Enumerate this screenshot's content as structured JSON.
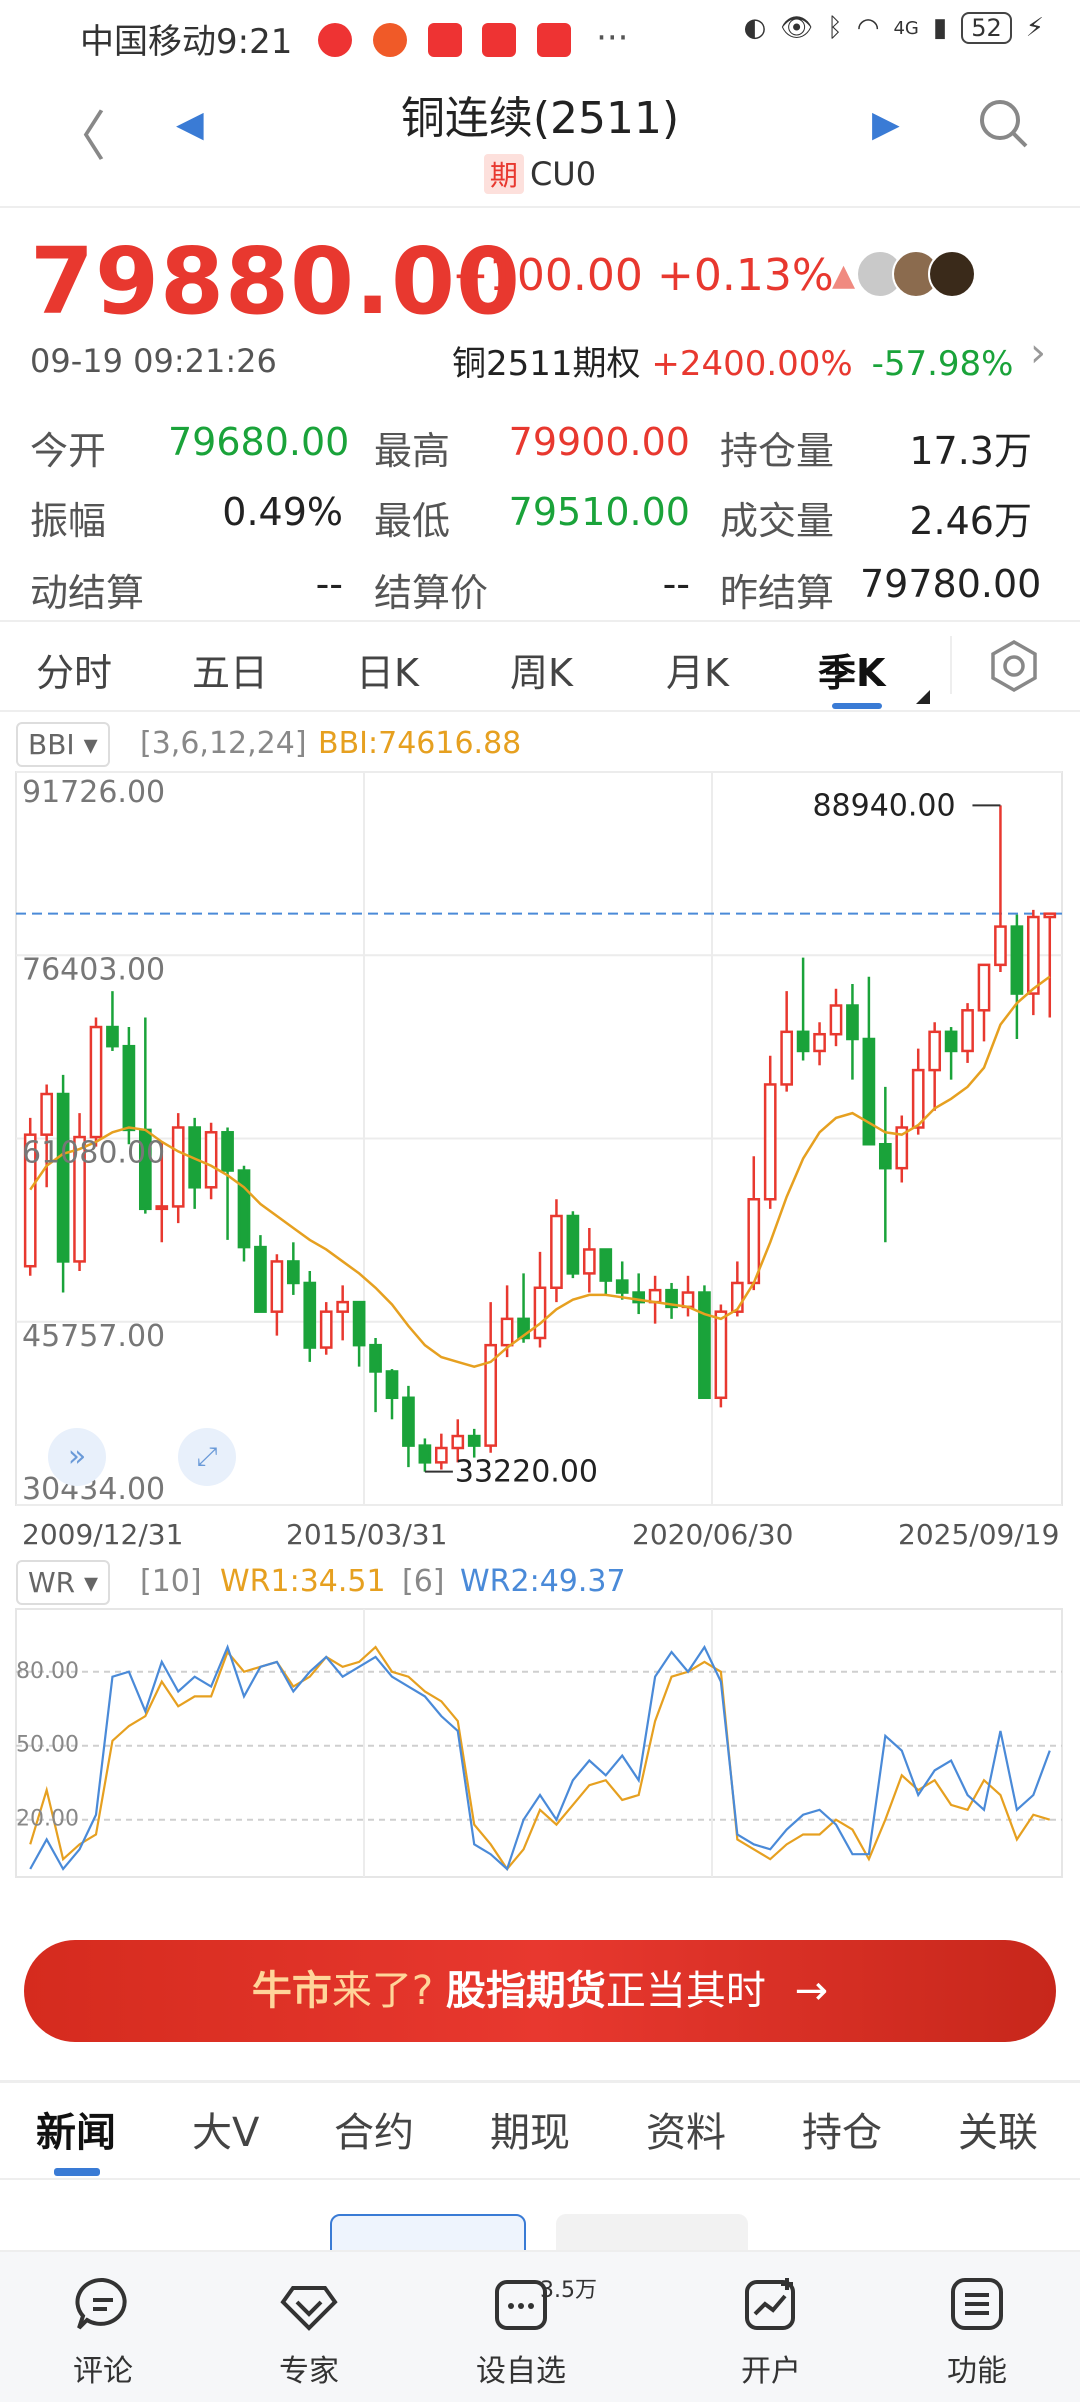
{
  "status_bar": {
    "carrier_time": "中国移动9:21",
    "network": "4G",
    "battery": "52"
  },
  "header": {
    "title": "铜连续(2511)",
    "badge": "期",
    "code": "CU0"
  },
  "quote": {
    "price": "79880.00",
    "change": "+100.00",
    "change_pct": "+0.13%",
    "datetime": "09-19 09:21:26",
    "option_name": "铜2511期权",
    "option_pct1": "+2400.00%",
    "option_pct2": "-57.98%"
  },
  "stats": {
    "open_label": "今开",
    "open": "79680.00",
    "high_label": "最高",
    "high": "79900.00",
    "oi_label": "持仓量",
    "oi": "17.3万",
    "amp_label": "振幅",
    "amp": "0.49%",
    "low_label": "最低",
    "low": "79510.00",
    "vol_label": "成交量",
    "vol": "2.46万",
    "dyn_label": "动结算",
    "dyn": "--",
    "settle_label": "结算价",
    "settle": "--",
    "prev_label": "昨结算",
    "prev": "79780.00"
  },
  "ktabs": [
    "分时",
    "五日",
    "日K",
    "周K",
    "月K",
    "季K"
  ],
  "main_chart": {
    "indicator": "BBI",
    "params": "[3,6,12,24]",
    "value_text": "BBI:74616.88",
    "y_labels": [
      "91726.00",
      "76403.00",
      "61080.00",
      "45757.00",
      "30434.00"
    ],
    "max_label": "88940.00",
    "min_label": "33220.00",
    "x_labels": [
      "2009/12/31",
      "2015/03/31",
      "2020/06/30",
      "2025/09/19"
    ]
  },
  "wr_chart": {
    "indicator": "WR",
    "p1": "[10]",
    "wr1": "WR1:34.51",
    "p2": "[6]",
    "wr2": "WR2:49.37",
    "y_labels": [
      "80.00",
      "50.00",
      "20.00"
    ]
  },
  "chart_data": [
    {
      "type": "candlestick",
      "title": "",
      "y_ticks": [
        91726.0,
        76403.0,
        61080.0,
        45757.0,
        30434.0
      ],
      "ylim": [
        30434.0,
        91726.0
      ],
      "x_ticks": [
        "2009/12/31",
        "2015/03/31",
        "2020/06/30",
        "2025/09/19"
      ],
      "annotations": {
        "max": 88940.0,
        "min": 33220.0,
        "current": 79880.0
      },
      "series": [
        {
          "name": "K",
          "ohlc": [
            [
              50400,
              62800,
              49600,
              61400
            ],
            [
              61400,
              65600,
              57000,
              64800
            ],
            [
              64800,
              66400,
              48200,
              50800
            ],
            [
              50800,
              63200,
              50000,
              61200
            ],
            [
              61200,
              71200,
              60400,
              70400
            ],
            [
              70400,
              73400,
              68400,
              68800
            ],
            [
              68800,
              70400,
              60600,
              61800
            ],
            [
              61800,
              71200,
              54800,
              55200
            ],
            [
              55200,
              60800,
              52400,
              55400
            ],
            [
              55400,
              63200,
              54000,
              62000
            ],
            [
              62000,
              62800,
              55200,
              57000
            ],
            [
              57000,
              62400,
              56000,
              61600
            ],
            [
              61600,
              62000,
              52600,
              58400
            ],
            [
              58400,
              58800,
              50800,
              52000
            ],
            [
              52000,
              53000,
              46800,
              46600
            ],
            [
              46600,
              51400,
              44600,
              50800
            ],
            [
              50800,
              52400,
              48000,
              49000
            ],
            [
              49000,
              50000,
              42400,
              43600
            ],
            [
              43600,
              47400,
              43000,
              46600
            ],
            [
              46600,
              48800,
              44200,
              47400
            ],
            [
              47400,
              47400,
              42000,
              43800
            ],
            [
              43800,
              44400,
              38200,
              41600
            ],
            [
              41600,
              41800,
              37600,
              39400
            ],
            [
              39400,
              40400,
              33600,
              35400
            ],
            [
              35400,
              36000,
              33220,
              34000
            ],
            [
              34000,
              36400,
              33400,
              35200
            ],
            [
              35200,
              37600,
              34000,
              36200
            ],
            [
              36200,
              36800,
              34400,
              35400
            ],
            [
              35400,
              47400,
              34800,
              43800
            ],
            [
              43800,
              48800,
              42800,
              46000
            ],
            [
              46000,
              49800,
              44000,
              44400
            ],
            [
              44400,
              51600,
              43600,
              48600
            ],
            [
              48600,
              56000,
              47400,
              54600
            ],
            [
              54600,
              55000,
              49400,
              49800
            ],
            [
              49800,
              53600,
              48200,
              51800
            ],
            [
              51800,
              51400,
              48000,
              49200
            ],
            [
              49200,
              50800,
              47600,
              48200
            ],
            [
              48200,
              49800,
              46400,
              47400
            ],
            [
              47400,
              49600,
              45600,
              48400
            ],
            [
              48400,
              49000,
              46000,
              47000
            ],
            [
              47000,
              49600,
              46200,
              48200
            ],
            [
              48200,
              48800,
              44000,
              39400
            ],
            [
              39400,
              47200,
              38600,
              46600
            ],
            [
              46600,
              50800,
              46200,
              49000
            ],
            [
              49000,
              59600,
              48400,
              56000
            ],
            [
              56000,
              68000,
              55200,
              65600
            ],
            [
              65600,
              73400,
              65000,
              70000
            ],
            [
              70000,
              76200,
              67600,
              68400
            ],
            [
              68400,
              70800,
              67200,
              69800
            ],
            [
              69800,
              73600,
              68800,
              72200
            ],
            [
              72200,
              74000,
              66000,
              69400
            ],
            [
              69400,
              74600,
              62000,
              60600
            ],
            [
              60600,
              65400,
              52400,
              58600
            ],
            [
              58600,
              63000,
              57400,
              62000
            ],
            [
              62000,
              68600,
              61400,
              66800
            ],
            [
              66800,
              70800,
              63400,
              70000
            ],
            [
              70000,
              70400,
              66000,
              68400
            ],
            [
              68400,
              72400,
              67400,
              71800
            ],
            [
              71800,
              74200,
              69200,
              75600
            ],
            [
              75600,
              88940,
              75000,
              78800
            ],
            [
              78800,
              79800,
              69400,
              73200
            ],
            [
              73200,
              80200,
              71400,
              79600
            ],
            [
              79600,
              79900,
              71200,
              79880
            ]
          ]
        },
        {
          "name": "BBI",
          "values": [
            56800,
            58800,
            59800,
            60200,
            60800,
            61600,
            62000,
            61800,
            60800,
            60000,
            59400,
            58800,
            58000,
            57000,
            55600,
            54600,
            53600,
            52600,
            51800,
            50800,
            49800,
            48600,
            47200,
            45400,
            43800,
            42800,
            42400,
            42000,
            42400,
            43600,
            44600,
            45600,
            46800,
            47600,
            48000,
            48000,
            47800,
            47600,
            47400,
            47200,
            47000,
            46400,
            46000,
            46800,
            49000,
            52400,
            56200,
            59400,
            61600,
            62800,
            63200,
            62400,
            61600,
            61400,
            62200,
            63600,
            64400,
            65400,
            67000,
            70600,
            72400,
            73600,
            74616.88
          ]
        }
      ]
    },
    {
      "type": "line",
      "title": "",
      "ylim": [
        0,
        100
      ],
      "y_ticks": [
        80.0,
        50.0,
        20.0
      ],
      "series": [
        {
          "name": "WR1",
          "values": [
            10,
            32,
            4,
            10,
            14,
            52,
            58,
            62,
            76,
            66,
            70,
            70,
            88,
            80,
            82,
            84,
            74,
            78,
            86,
            82,
            84,
            90,
            80,
            78,
            72,
            68,
            60,
            18,
            10,
            0,
            8,
            24,
            18,
            26,
            34,
            36,
            28,
            30,
            60,
            78,
            80,
            84,
            80,
            12,
            8,
            4,
            10,
            14,
            14,
            20,
            16,
            4,
            20,
            38,
            32,
            36,
            26,
            24,
            36,
            30,
            12,
            22,
            20
          ]
        },
        {
          "name": "WR2",
          "values": [
            0,
            12,
            0,
            8,
            22,
            78,
            80,
            64,
            84,
            72,
            78,
            74,
            90,
            70,
            82,
            84,
            72,
            80,
            86,
            78,
            82,
            86,
            78,
            74,
            70,
            62,
            56,
            10,
            6,
            0,
            20,
            30,
            20,
            36,
            44,
            38,
            46,
            36,
            78,
            88,
            80,
            90,
            76,
            14,
            10,
            8,
            16,
            22,
            24,
            18,
            6,
            6,
            54,
            48,
            30,
            40,
            44,
            30,
            24,
            56,
            24,
            30,
            48
          ]
        }
      ]
    }
  ],
  "banner": {
    "p1": "牛市",
    "p2": "来了?",
    "p3": "股指期货",
    "p4": "正当其时",
    "arrow": "→"
  },
  "news_tabs": [
    "新闻",
    "大V",
    "合约",
    "期现",
    "资料",
    "持仓",
    "关联"
  ],
  "bottom_bar": {
    "items": [
      "评论",
      "专家",
      "设自选",
      "开户",
      "功能"
    ],
    "badge": "3.5万"
  }
}
